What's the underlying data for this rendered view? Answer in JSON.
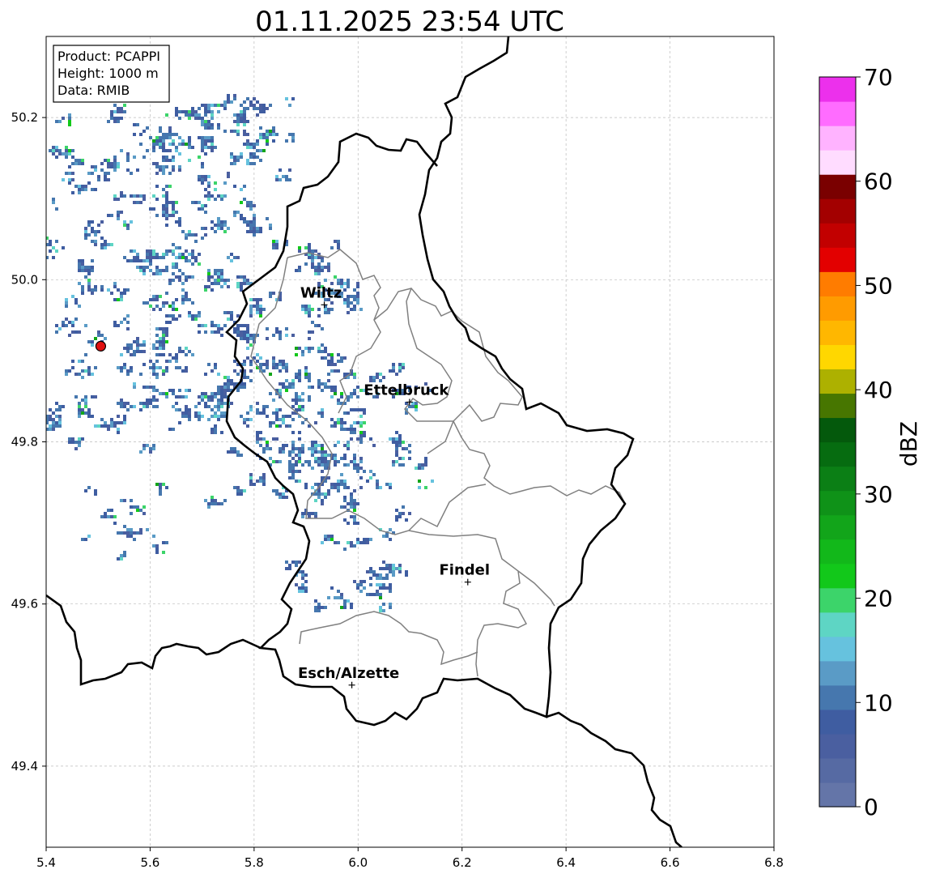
{
  "title": "01.11.2025 23:54 UTC",
  "info_box": {
    "lines": [
      "Product: PCAPPI",
      "Height: 1000 m",
      "Data: RMIB"
    ]
  },
  "map": {
    "lon_range": [
      5.4,
      6.8
    ],
    "lat_range": [
      49.3,
      50.3
    ],
    "x_ticks": [
      "5.4",
      "5.6",
      "5.8",
      "6.0",
      "6.2",
      "6.4",
      "6.6",
      "6.8"
    ],
    "y_ticks": [
      "49.4",
      "49.6",
      "49.8",
      "50.0",
      "50.2"
    ],
    "grid": true,
    "radar_site": {
      "lon": 5.505,
      "lat": 49.918,
      "color": "#e01010"
    },
    "cities": [
      {
        "name": "Wiltz",
        "lon": 5.935,
        "lat": 49.969
      },
      {
        "name": "Ettelbruck",
        "lon": 6.099,
        "lat": 49.849
      },
      {
        "name": "Findel",
        "lon": 6.211,
        "lat": 49.627
      },
      {
        "name": "Esch/Alzette",
        "lon": 5.988,
        "lat": 49.5
      }
    ]
  },
  "colorbar": {
    "label": "dBZ",
    "ticks": [
      "0",
      "10",
      "20",
      "30",
      "40",
      "50",
      "60",
      "70"
    ],
    "range": [
      0,
      70
    ],
    "colors": [
      "#6475a8",
      "#566aa3",
      "#4a5fa0",
      "#3f5da1",
      "#4677ae",
      "#5a9bc6",
      "#66c2de",
      "#5ed5c4",
      "#3cd46a",
      "#12c81a",
      "#12b81a",
      "#12a51a",
      "#0f9218",
      "#0b7f15",
      "#066c10",
      "#04590c",
      "#477600",
      "#adb100",
      "#ffd700",
      "#ffb700",
      "#ff9b00",
      "#ff7c00",
      "#e30000",
      "#c20000",
      "#a30000",
      "#7a0000",
      "#ffdcff",
      "#ffb3ff",
      "#ff6cff",
      "#ec30ec"
    ]
  }
}
